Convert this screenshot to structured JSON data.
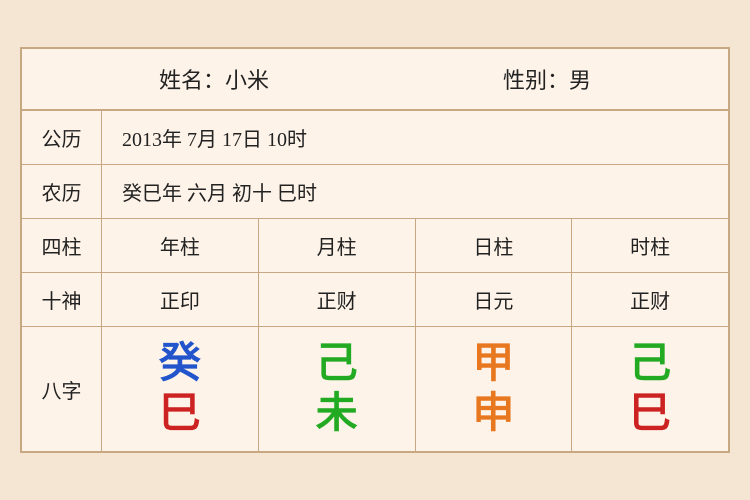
{
  "header": {
    "name_label": "姓名：小米",
    "gender_label": "性别：男"
  },
  "gregorian": {
    "label": "公历",
    "value": "2013年 7月 17日 10时"
  },
  "lunar": {
    "label": "农历",
    "value": "癸巳年 六月 初十 巳时"
  },
  "pillars": {
    "label": "四柱",
    "year": "年柱",
    "month": "月柱",
    "day": "日柱",
    "hour": "时柱"
  },
  "shishen": {
    "label": "十神",
    "year": "正印",
    "month": "正财",
    "day": "日元",
    "hour": "正财"
  },
  "bazi": {
    "label": "八字",
    "year_top": "癸",
    "year_top_color": "blue",
    "year_bottom": "巳",
    "year_bottom_color": "red",
    "month_top": "己",
    "month_top_color": "green",
    "month_bottom": "未",
    "month_bottom_color": "green",
    "day_top": "甲",
    "day_top_color": "orange",
    "day_bottom": "申",
    "day_bottom_color": "orange",
    "hour_top": "己",
    "hour_top_color": "green",
    "hour_bottom": "巳",
    "hour_bottom_color": "red"
  }
}
